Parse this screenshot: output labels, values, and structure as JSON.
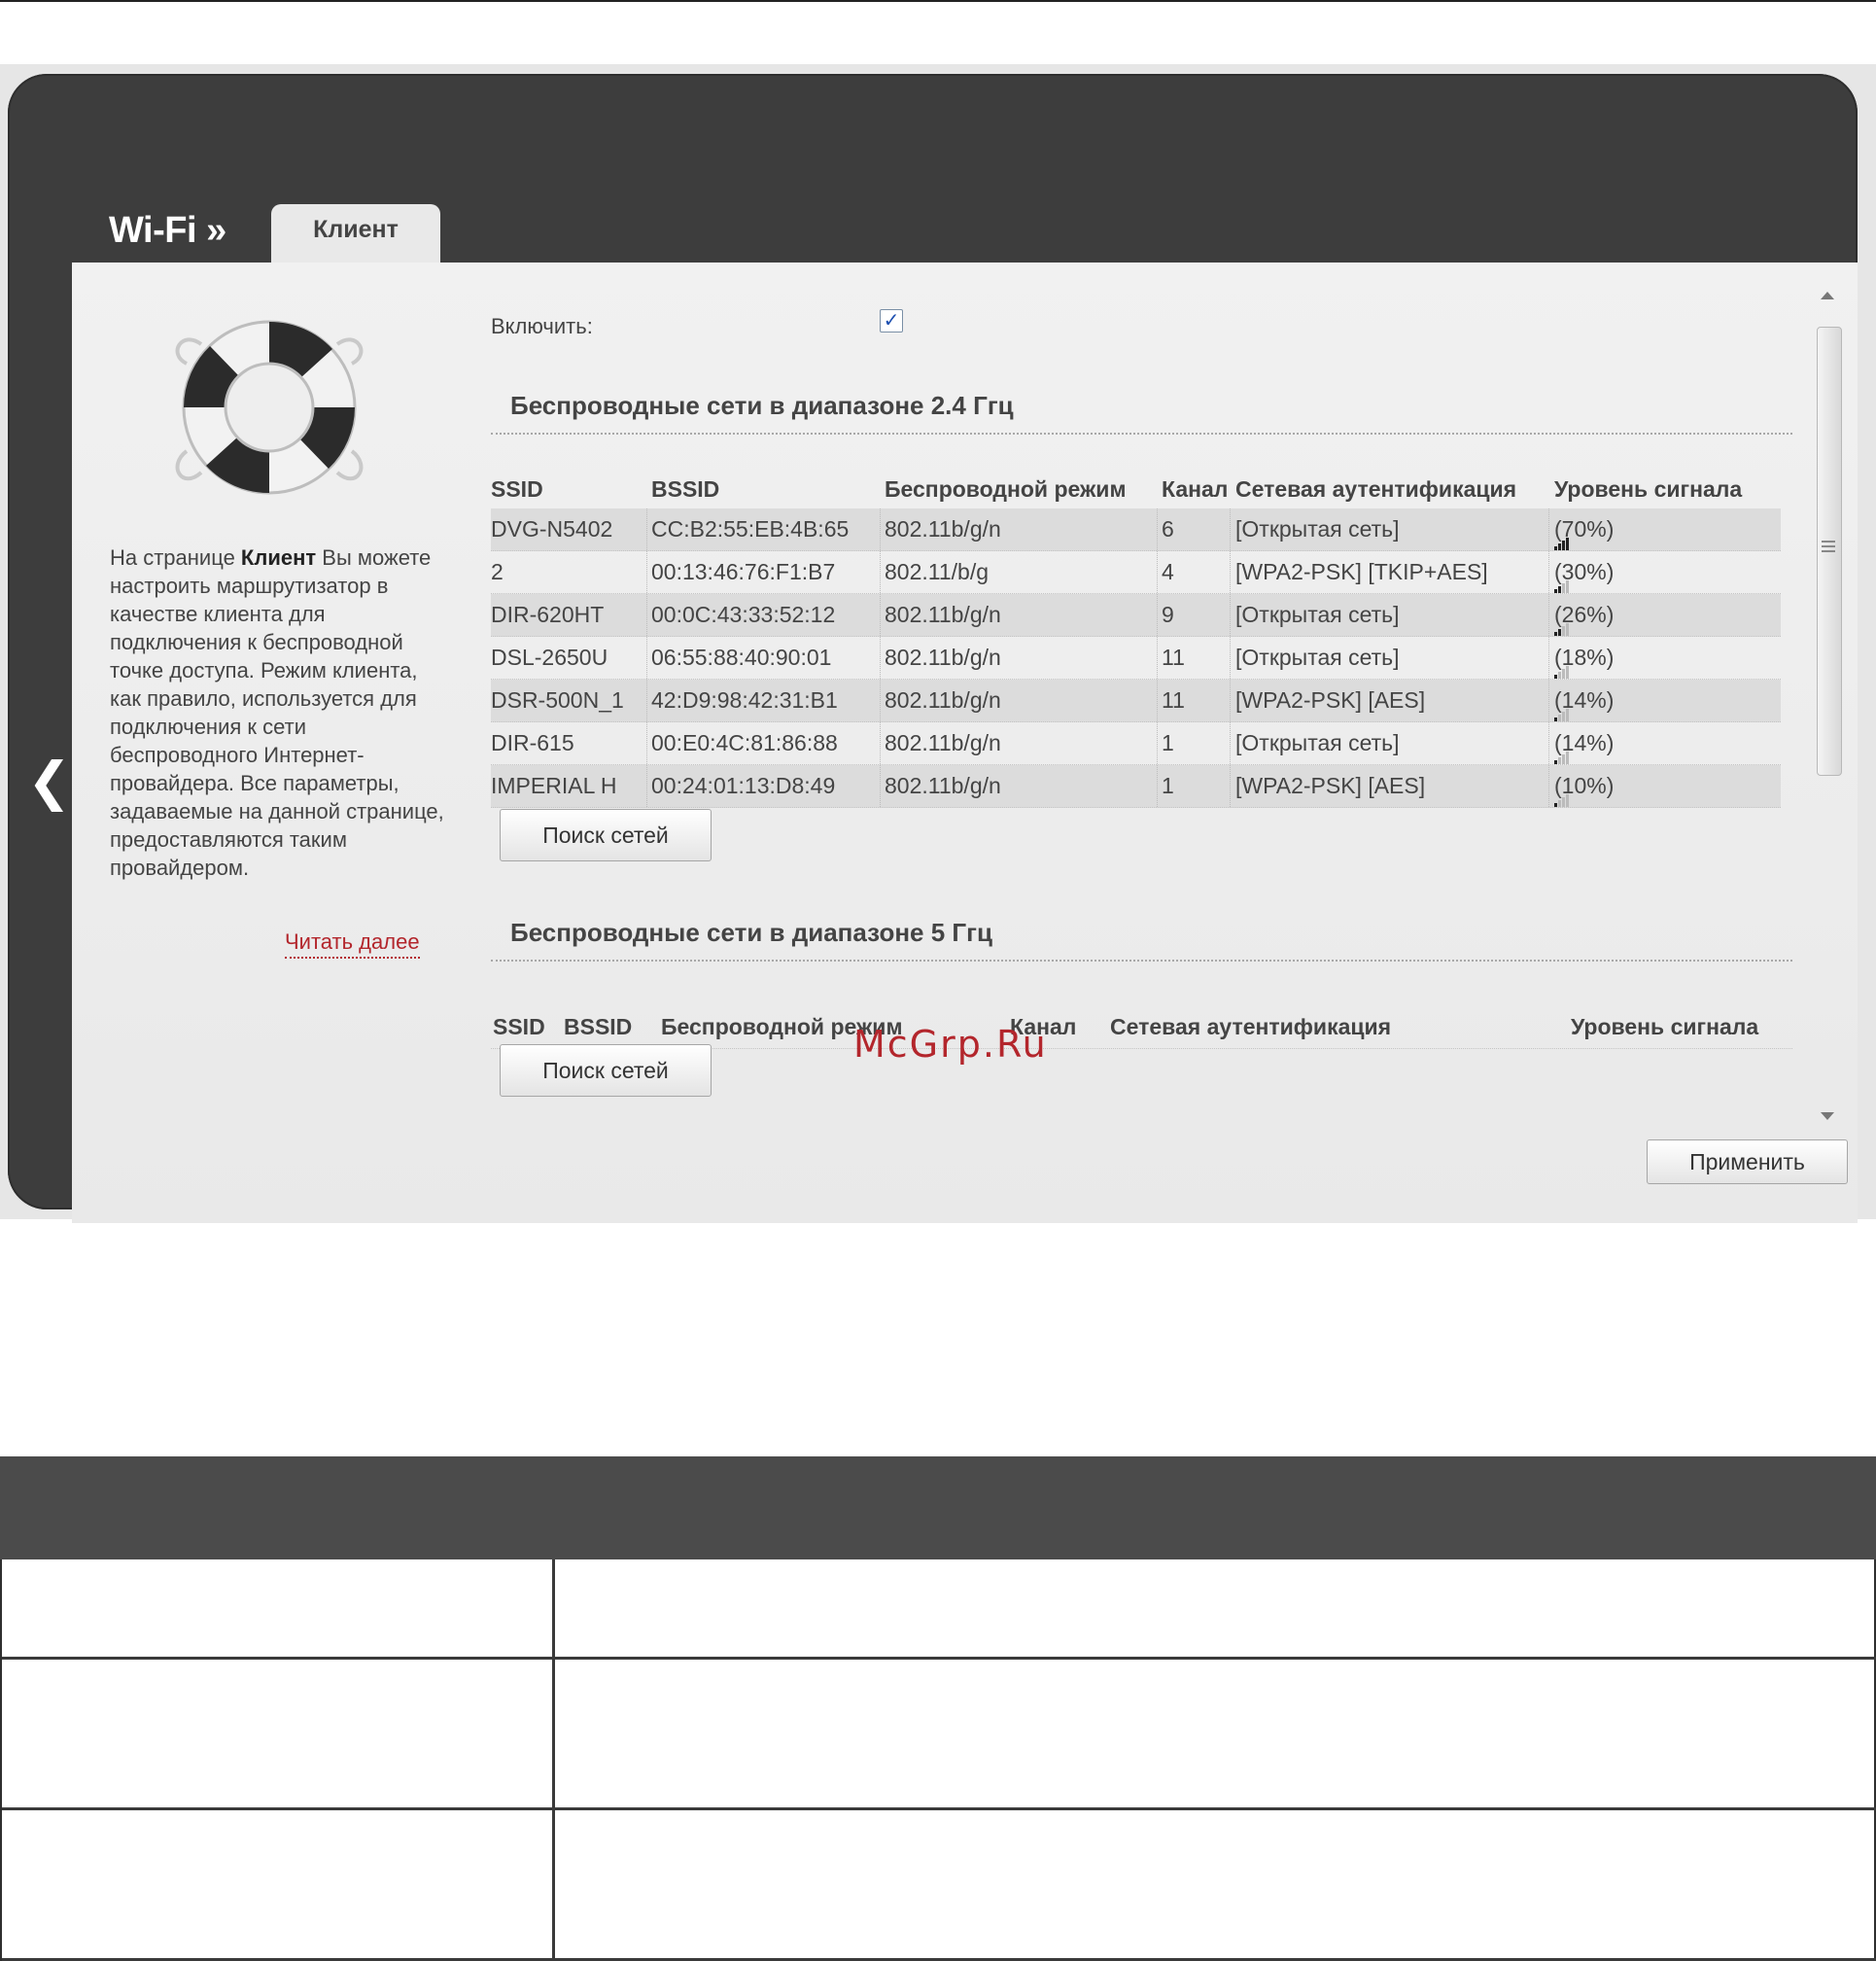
{
  "header": {
    "breadcrumb": "Wi-Fi »",
    "tab_label": "Клиент"
  },
  "info": {
    "text_before": "На странице ",
    "text_bold": "Клиент",
    "text_after": " Вы можете настроить маршрутизатор в качестве клиента для подключения к беспроводной точке доступа. Режим клиента, как правило, используется для подключения к сети беспроводного Интернет-провайдера. Все параметры, задаваемые на данной странице, предоставляются таким провайдером.",
    "read_more": "Читать далее"
  },
  "enable": {
    "label": "Включить:",
    "checked": true,
    "check_glyph": "✓"
  },
  "band24": {
    "title": "Беспроводные сети в диапазоне 2.4 Ггц",
    "columns": [
      "SSID",
      "BSSID",
      "Беспроводной режим",
      "Канал",
      "Сетевая аутентификация",
      "Уровень сигнала"
    ],
    "rows": [
      {
        "ssid": "DVG-N5402",
        "bssid": "CC:B2:55:EB:4B:65",
        "mode": "802.11b/g/n",
        "channel": "6",
        "auth": "[Открытая сеть]",
        "signal": "(70%)",
        "bars": 4
      },
      {
        "ssid": "2",
        "bssid": "00:13:46:76:F1:B7",
        "mode": "802.11/b/g",
        "channel": "4",
        "auth": "[WPA2-PSK] [TKIP+AES]",
        "signal": "(30%)",
        "bars": 2
      },
      {
        "ssid": "DIR-620HT",
        "bssid": "00:0C:43:33:52:12",
        "mode": "802.11b/g/n",
        "channel": "9",
        "auth": "[Открытая сеть]",
        "signal": "(26%)",
        "bars": 2
      },
      {
        "ssid": "DSL-2650U",
        "bssid": "06:55:88:40:90:01",
        "mode": "802.11b/g/n",
        "channel": "11",
        "auth": "[Открытая сеть]",
        "signal": "(18%)",
        "bars": 1
      },
      {
        "ssid": "DSR-500N_1",
        "bssid": "42:D9:98:42:31:B1",
        "mode": "802.11b/g/n",
        "channel": "11",
        "auth": "[WPA2-PSK] [AES]",
        "signal": "(14%)",
        "bars": 1
      },
      {
        "ssid": "DIR-615",
        "bssid": "00:E0:4C:81:86:88",
        "mode": "802.11b/g/n",
        "channel": "1",
        "auth": "[Открытая сеть]",
        "signal": "(14%)",
        "bars": 1
      },
      {
        "ssid": "IMPERIAL H",
        "bssid": "00:24:01:13:D8:49",
        "mode": "802.11b/g/n",
        "channel": "1",
        "auth": "[WPA2-PSK] [AES]",
        "signal": "(10%)",
        "bars": 1
      }
    ],
    "search_button": "Поиск сетей"
  },
  "band5": {
    "title": "Беспроводные сети в диапазоне 5 Ггц",
    "columns": [
      "SSID",
      "BSSID",
      "Беспроводной режим",
      "Канал",
      "Сетевая аутентификация",
      "Уровень сигнала"
    ],
    "search_button": "Поиск сетей"
  },
  "apply_button": "Применить",
  "watermark": "McGrp.Ru",
  "icons": {
    "back": "chevron-left-icon",
    "help": "lifebuoy-icon",
    "signal": "signal-bars-icon"
  },
  "colors": {
    "frame": "#3d3d3d",
    "panel": "#eeeeee",
    "link": "#b3262c",
    "table_header": "#4b4b4b"
  }
}
